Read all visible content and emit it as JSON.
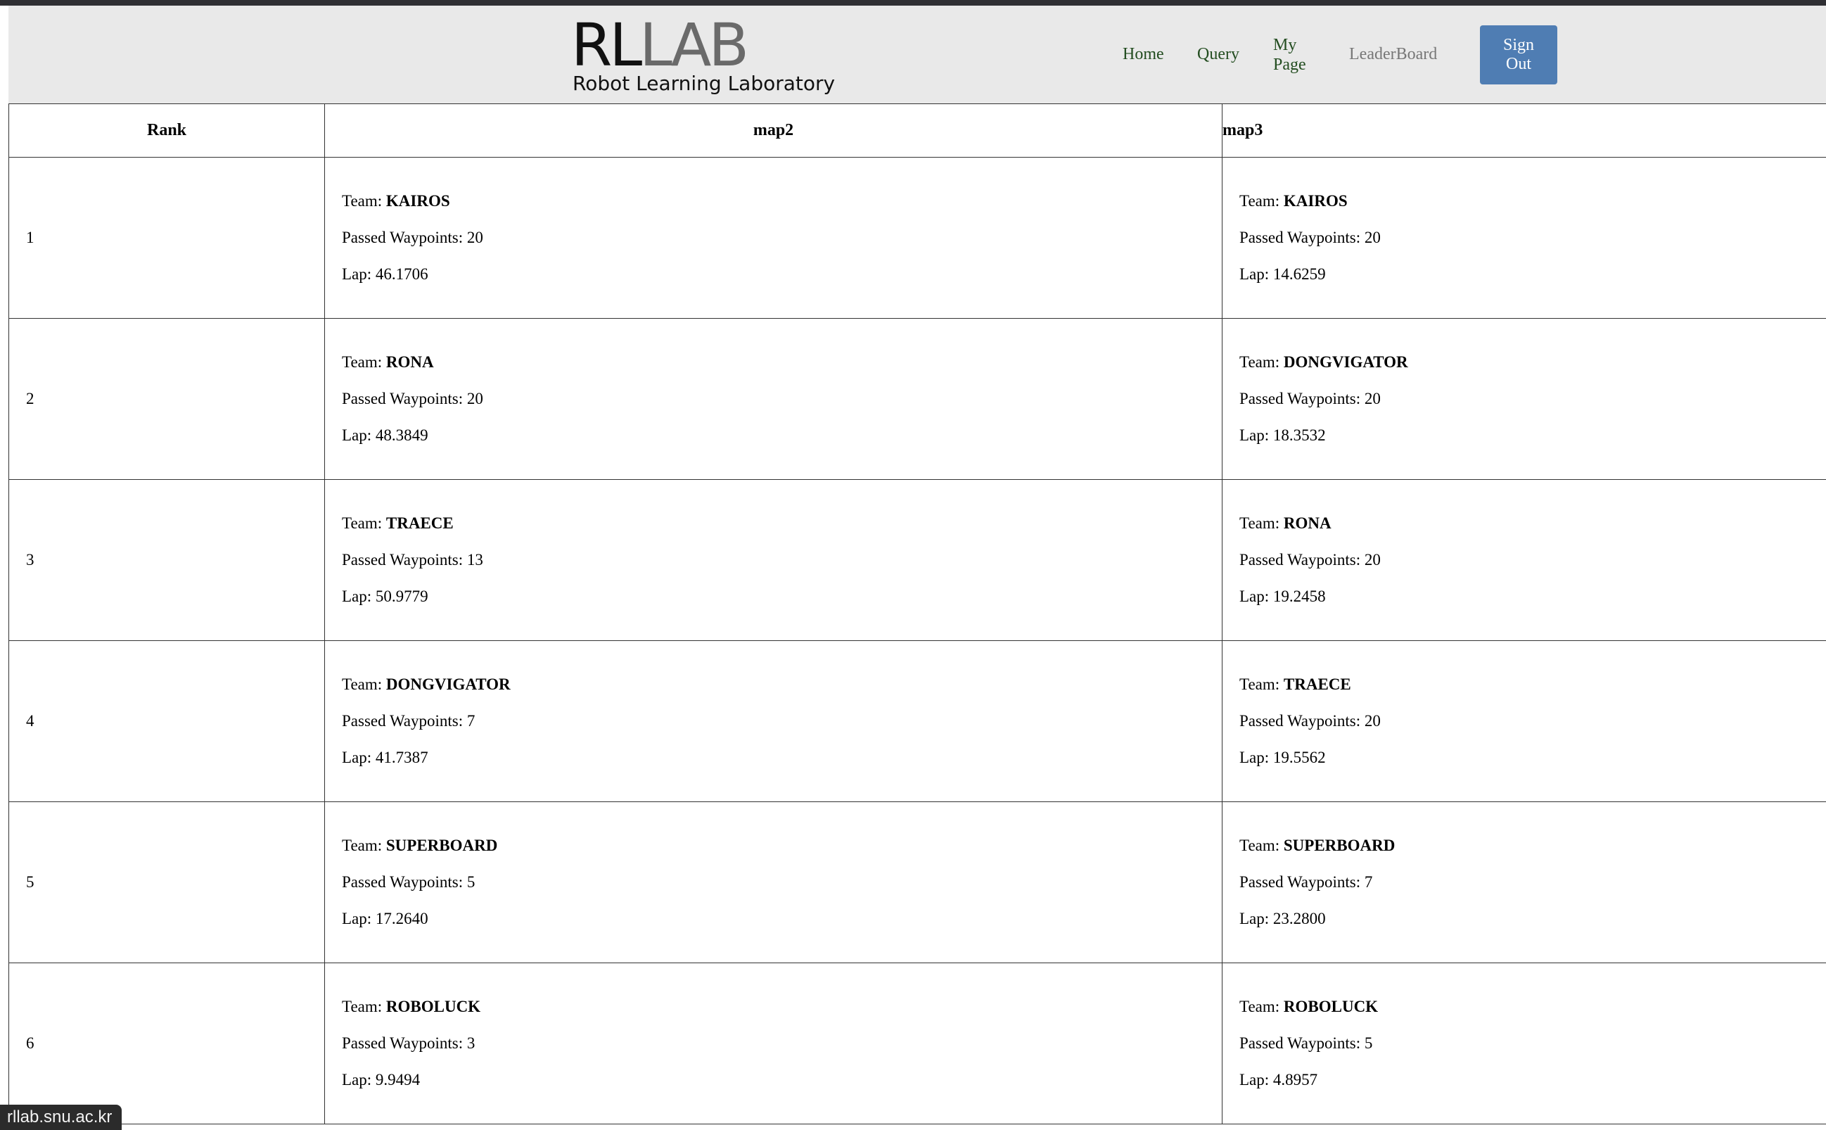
{
  "header": {
    "logo_rl": "RL",
    "logo_lab": "LAB",
    "logo_subtitle": "Robot Learning Laboratory",
    "nav": {
      "home": "Home",
      "query": "Query",
      "my_line1": "My",
      "my_line2": "Page",
      "leaderboard": "LeaderBoard",
      "signout_line1": "Sign",
      "signout_line2": "Out"
    }
  },
  "table": {
    "headers": {
      "rank": "Rank",
      "map2": "map2",
      "map3": "map3"
    },
    "labels": {
      "team": "Team: ",
      "waypoints": "Passed Waypoints: ",
      "lap": "Lap: "
    },
    "rows": [
      {
        "rank": "1",
        "map2": {
          "team": "KAIROS",
          "waypoints": "20",
          "lap": "46.1706"
        },
        "map3": {
          "team": "KAIROS",
          "waypoints": "20",
          "lap": "14.6259"
        }
      },
      {
        "rank": "2",
        "map2": {
          "team": "RONA",
          "waypoints": "20",
          "lap": "48.3849"
        },
        "map3": {
          "team": "DONGVIGATOR",
          "waypoints": "20",
          "lap": "18.3532"
        }
      },
      {
        "rank": "3",
        "map2": {
          "team": "TRAECE",
          "waypoints": "13",
          "lap": "50.9779"
        },
        "map3": {
          "team": "RONA",
          "waypoints": "20",
          "lap": "19.2458"
        }
      },
      {
        "rank": "4",
        "map2": {
          "team": "DONGVIGATOR",
          "waypoints": "7",
          "lap": "41.7387"
        },
        "map3": {
          "team": "TRAECE",
          "waypoints": "20",
          "lap": "19.5562"
        }
      },
      {
        "rank": "5",
        "map2": {
          "team": "SUPERBOARD",
          "waypoints": "5",
          "lap": "17.2640"
        },
        "map3": {
          "team": "SUPERBOARD",
          "waypoints": "7",
          "lap": "23.2800"
        }
      },
      {
        "rank": "6",
        "map2": {
          "team": "ROBOLUCK",
          "waypoints": "3",
          "lap": "9.9494"
        },
        "map3": {
          "team": "ROBOLUCK",
          "waypoints": "5",
          "lap": "4.8957"
        }
      }
    ]
  },
  "status_bar": {
    "url": "rllab.snu.ac.kr"
  }
}
